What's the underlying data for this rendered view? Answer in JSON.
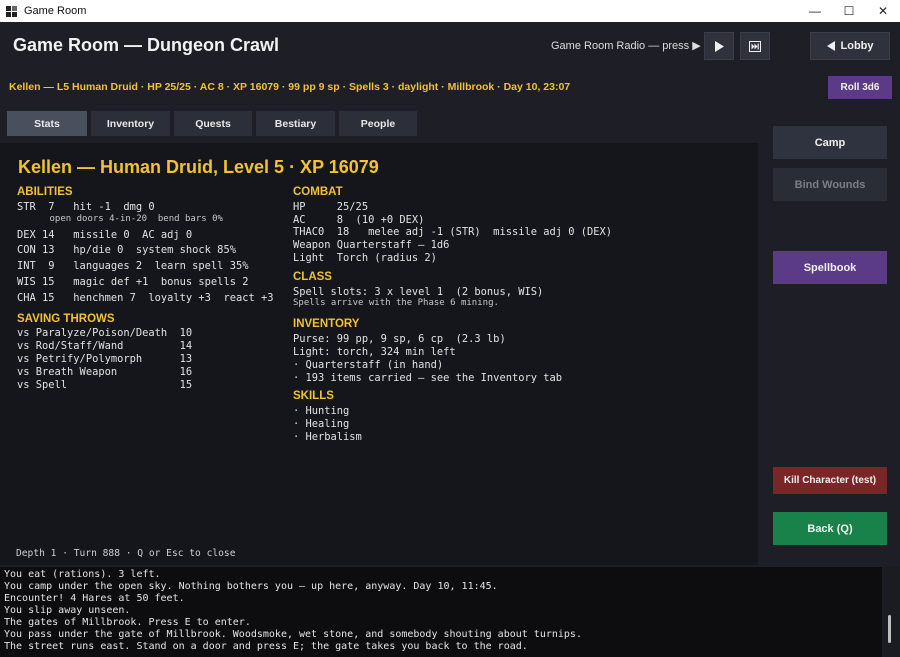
{
  "window": {
    "title": "Game Room",
    "minimize_glyph": "—",
    "maximize_glyph": "☐",
    "close_glyph": "✕"
  },
  "header": {
    "title": "Game Room — Dungeon Crawl",
    "radio_label": "Game Room Radio — press ▶",
    "lobby_label": "Lobby"
  },
  "status_line": "Kellen — L5 Human Druid · HP 25/25 · AC 8 · XP 16079 · 99 pp 9 sp · Spells 3 · daylight · Millbrook · Day 10, 23:07",
  "roll_button": "Roll 3d6",
  "tabs": [
    {
      "label": "Stats",
      "active": true
    },
    {
      "label": "Inventory",
      "active": false
    },
    {
      "label": "Quests",
      "active": false
    },
    {
      "label": "Bestiary",
      "active": false
    },
    {
      "label": "People",
      "active": false
    }
  ],
  "sheet": {
    "title": "Kellen — Human Druid, Level 5   ·   XP 16079",
    "abilities_heading": "ABILITIES",
    "abilities": [
      "STR  7   hit -1  dmg 0",
      "DEX 14   missile 0  AC adj 0",
      "CON 13   hp/die 0  system shock 85%",
      "INT  9   languages 2  learn spell 35%",
      "WIS 15   magic def +1  bonus spells 2",
      "CHA 15   henchmen 7  loyalty +3  react +3"
    ],
    "str_detail": "      open doors 4-in-20  bend bars 0%",
    "saves_heading": "SAVING THROWS",
    "saves": [
      "vs Paralyze/Poison/Death  10",
      "vs Rod/Staff/Wand         14",
      "vs Petrify/Polymorph      13",
      "vs Breath Weapon          16",
      "vs Spell                  15"
    ],
    "combat_heading": "COMBAT",
    "combat": [
      "HP     25/25",
      "AC     8  (10 +0 DEX)",
      "THAC0  18   melee adj -1 (STR)  missile adj 0 (DEX)",
      "Weapon Quarterstaff — 1d6",
      "Light  Torch (radius 2)"
    ],
    "class_heading": "CLASS",
    "class_line": "Spell slots: 3 x level 1  (2 bonus, WIS)",
    "class_note": "Spells arrive with the Phase 6 mining.",
    "inventory_heading": "INVENTORY",
    "inventory": [
      "Purse: 99 pp, 9 sp, 6 cp  (2.3 lb)",
      "Light: torch, 324 min left",
      "· Quarterstaff (in hand)",
      "· 193 items carried — see the Inventory tab"
    ],
    "skills_heading": "SKILLS",
    "skills": [
      "· Hunting",
      "· Healing",
      "· Herbalism"
    ],
    "footer": "Depth 1 · Turn 888 · Q or Esc to close"
  },
  "sidebar": {
    "camp": "Camp",
    "bind_wounds": "Bind Wounds",
    "spellbook": "Spellbook",
    "kill": "Kill Character (test)",
    "back": "Back (Q)"
  },
  "log": [
    "You eat (rations). 3 left.",
    "You camp under the open sky. Nothing bothers you — up here, anyway. Day 10, 11:45.",
    "Encounter! 4 Hares at 50 feet.",
    "You slip away unseen.",
    "The gates of Millbrook. Press E to enter.",
    "You pass under the gate of Millbrook. Woodsmoke, wet stone, and somebody shouting about turnips.",
    "The street runs east. Stand on a door and press E; the gate takes you back to the road."
  ],
  "colors": {
    "accent_gold": "#f2c230",
    "purple": "#5b3a88",
    "danger": "#7a2626",
    "success": "#18824a"
  }
}
